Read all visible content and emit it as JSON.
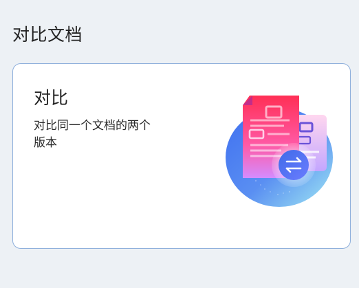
{
  "page": {
    "title": "对比文档"
  },
  "card": {
    "title": "对比",
    "description": "对比同一个文档的两个版本",
    "illustration_icon": "compare-documents-icon",
    "colors": {
      "accent_blue": "#4a76e8",
      "accent_pink": "#ff3d7f",
      "accent_purple": "#8a4dff"
    }
  }
}
